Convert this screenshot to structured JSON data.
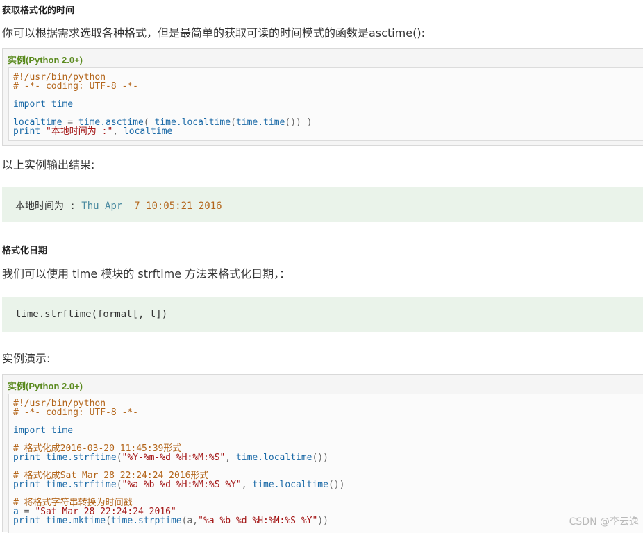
{
  "section1": {
    "heading": "获取格式化的时间",
    "intro": "你可以根据需求选取各种格式，但是最简单的获取可读的时间模式的函数是asctime():"
  },
  "example1": {
    "title": "实例(Python 2.0+)",
    "line1": "#!/usr/bin/python",
    "line2": "# -*- coding: UTF-8 -*-",
    "line3_kw": "import",
    "line3_mod": "time",
    "line4_a": "localtime",
    "line4_b": " = ",
    "line4_c": "time.asctime",
    "line4_d": "( ",
    "line4_e": "time.localtime",
    "line4_f": "(",
    "line4_g": "time.time",
    "line4_h": "()) )",
    "line5_kw": "print",
    "line5_str": "\"本地时间为 :\"",
    "line5_sep": ", ",
    "line5_var": "localtime"
  },
  "output_caption": "以上实例输出结果:",
  "output1": {
    "label": "本地时间为",
    "colon": " : ",
    "day": "Thu Apr ",
    "rest": " 7 10:05:21 2016"
  },
  "section2": {
    "heading": "格式化日期",
    "intro": "我们可以使用 time 模块的 strftime 方法来格式化日期，：",
    "signature": "time.strftime(format[, t])",
    "demo_caption": "实例演示:"
  },
  "example2": {
    "title": "实例(Python 2.0+)",
    "l1": "#!/usr/bin/python",
    "l2": "# -*- coding: UTF-8 -*-",
    "l3_kw": "import",
    "l3_mod": "time",
    "l4": "# 格式化成2016-03-20 11:45:39形式",
    "l5_kw": "print",
    "l5_fn": "time.strftime",
    "l5_p": "(",
    "l5_str": "\"%Y-%m-%d %H:%M:%S\"",
    "l5_sep": ", ",
    "l5_fn2": "time.localtime",
    "l5_end": "())",
    "l6": "# 格式化成Sat Mar 28 22:24:24 2016形式",
    "l7_kw": "print",
    "l7_fn": "time.strftime",
    "l7_p": "(",
    "l7_str": "\"%a %b %d %H:%M:%S %Y\"",
    "l7_sep": ", ",
    "l7_fn2": "time.localtime",
    "l7_end": "())",
    "l8": "# 将格式字符串转换为时间戳",
    "l9_var": "a",
    "l9_eq": " = ",
    "l9_str": "\"Sat Mar 28 22:24:24 2016\"",
    "l10_kw": "print",
    "l10_fn": "time.mktime",
    "l10_p": "(",
    "l10_fn2": "time.strptime",
    "l10_args": "(a,",
    "l10_str": "\"%a %b %d %H:%M:%S %Y\"",
    "l10_end": "))"
  },
  "watermark": "CSDN @李云逸"
}
